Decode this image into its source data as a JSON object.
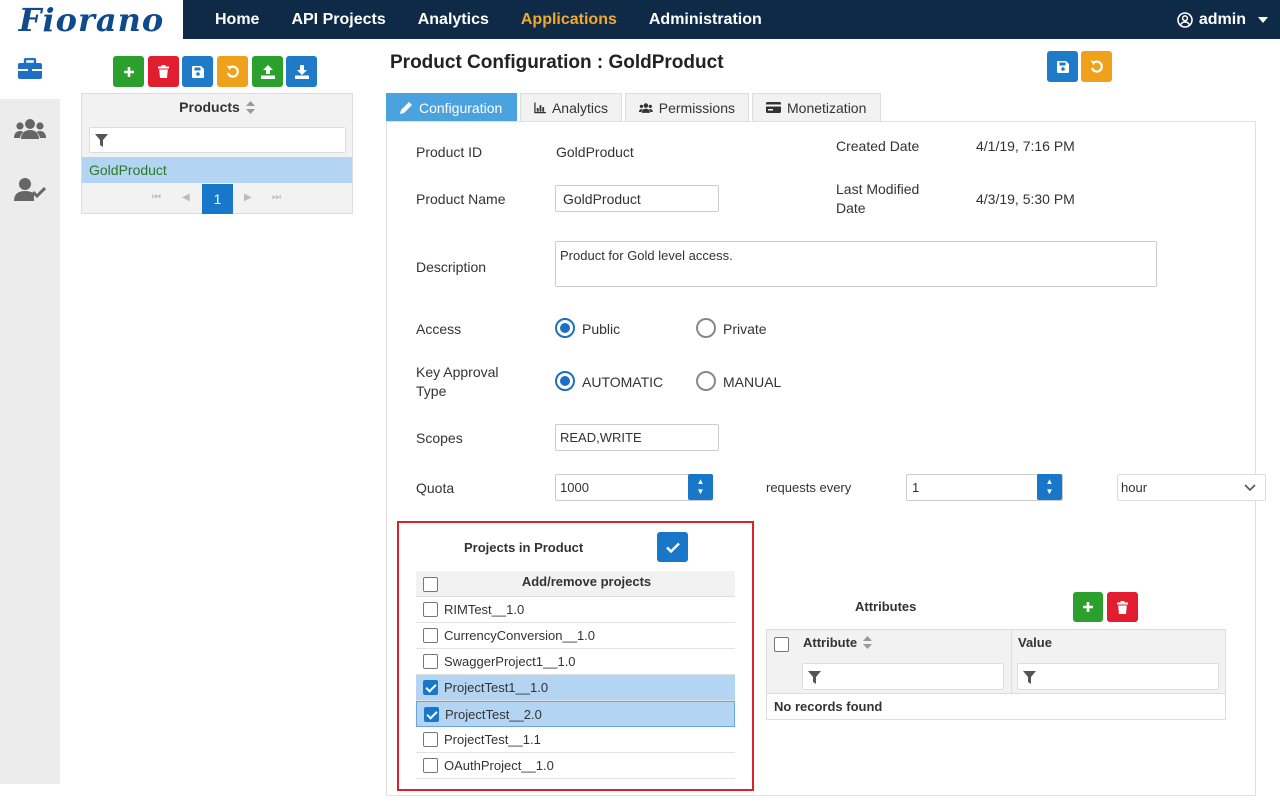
{
  "app": {
    "logo": "Fiorano"
  },
  "nav": {
    "items": [
      {
        "label": "Home"
      },
      {
        "label": "API Projects"
      },
      {
        "label": "Analytics"
      },
      {
        "label": "Applications",
        "active": true
      },
      {
        "label": "Administration"
      }
    ],
    "user": "admin"
  },
  "products_panel": {
    "header": "Products",
    "items": [
      "GoldProduct"
    ],
    "page": "1"
  },
  "page_title": "Product Configuration : GoldProduct",
  "tabs": [
    {
      "label": "Configuration",
      "icon": "pencil-icon"
    },
    {
      "label": "Analytics",
      "icon": "bar-chart-icon"
    },
    {
      "label": "Permissions",
      "icon": "users-icon"
    },
    {
      "label": "Monetization",
      "icon": "credit-card-icon"
    }
  ],
  "form": {
    "product_id_label": "Product ID",
    "product_id_value": "GoldProduct",
    "created_date_label": "Created Date",
    "created_date_value": "4/1/19, 7:16 PM",
    "product_name_label": "Product Name",
    "product_name_value": "GoldProduct",
    "last_modified_label_1": "Last Modified",
    "last_modified_label_2": "Date",
    "last_modified_value": "4/3/19, 5:30 PM",
    "description_label": "Description",
    "description_value": "Product for Gold level access.",
    "access_label": "Access",
    "access_public": "Public",
    "access_private": "Private",
    "key_approval_label_1": "Key Approval",
    "key_approval_label_2": "Type",
    "key_automatic": "AUTOMATIC",
    "key_manual": "MANUAL",
    "scopes_label": "Scopes",
    "scopes_value": "READ,WRITE",
    "quota_label": "Quota",
    "quota_value": "1000",
    "requests_every_label": "requests every",
    "requests_every_value": "1",
    "unit_value": "hour"
  },
  "projects": {
    "title": "Projects in Product",
    "header": "Add/remove projects",
    "rows": [
      {
        "name": "RIMTest__1.0",
        "checked": false
      },
      {
        "name": "CurrencyConversion__1.0",
        "checked": false
      },
      {
        "name": "SwaggerProject1__1.0",
        "checked": false
      },
      {
        "name": "ProjectTest1__1.0",
        "checked": true
      },
      {
        "name": "ProjectTest__2.0",
        "checked": true
      },
      {
        "name": "ProjectTest__1.1",
        "checked": false
      },
      {
        "name": "OAuthProject__1.0",
        "checked": false
      }
    ]
  },
  "attributes": {
    "title": "Attributes",
    "col_attribute": "Attribute",
    "col_value": "Value",
    "empty": "No records found"
  },
  "colors": {
    "navbar": "#0e2a47",
    "accent": "#f6a828",
    "primary": "#1877c9",
    "danger": "#e11d2f",
    "success": "#2ca02c",
    "highlight_border": "#d9222a"
  }
}
